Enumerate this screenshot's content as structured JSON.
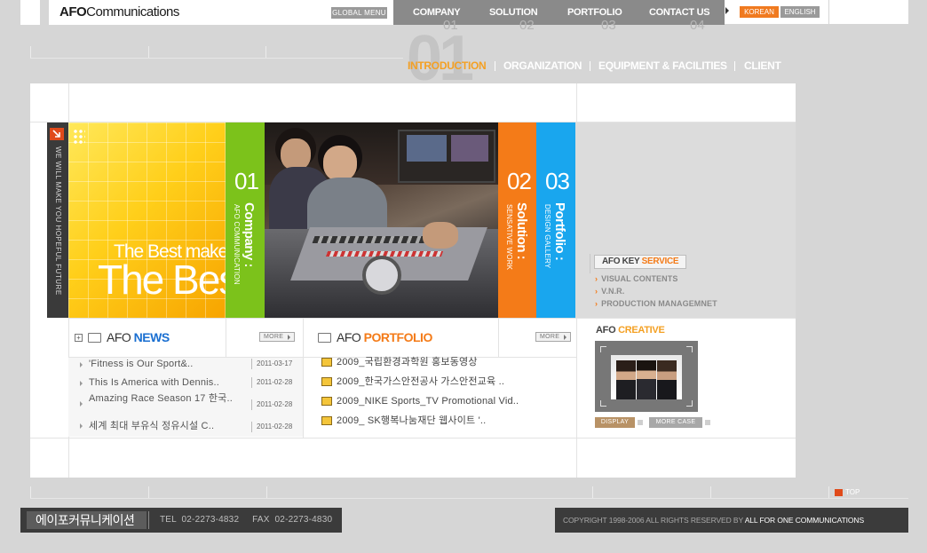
{
  "header": {
    "logo_bold": "AFO",
    "logo_rest": "Communications",
    "global_menu": "GLOBAL MENU",
    "nav": [
      {
        "label": "COMPANY",
        "num": "01"
      },
      {
        "label": "SOLUTION",
        "num": "02"
      },
      {
        "label": "PORTFOLIO",
        "num": "03"
      },
      {
        "label": "CONTACT US",
        "num": "04"
      }
    ],
    "lang_korean": "KOREAN",
    "lang_english": "ENGLISH",
    "big_number": "01"
  },
  "subnav": [
    {
      "label": "INTRODUCTION",
      "active": true
    },
    {
      "label": "ORGANIZATION",
      "active": false
    },
    {
      "label": "EQUIPMENT & FACILITIES",
      "active": false
    },
    {
      "label": "CLIENT",
      "active": false
    }
  ],
  "banner": {
    "side_text": "WE WILL MAKE YOU HOPEFUL FUTURE",
    "tagline_small": "The Best make",
    "tagline_big": "The Best",
    "bands": [
      {
        "num": "01",
        "title": "Company :",
        "sub": "AFO COMMUNICATION"
      },
      {
        "num": "02",
        "title": "Solution :",
        "sub": "SENSATIVE WORK"
      },
      {
        "num": "03",
        "title": "Portfolio :",
        "sub": "DESIGN GALLERY"
      }
    ],
    "colors": {
      "yellow": "#ffcf1a",
      "green": "#7cc21b",
      "orange": "#f47b18",
      "blue": "#19a6ee"
    }
  },
  "key_service": {
    "title_prefix": "AFO KEY ",
    "title_highlight": "SERVICE",
    "items": [
      "VISUAL CONTENTS",
      "V.N.R.",
      "PRODUCTION MANAGEMNET"
    ]
  },
  "news": {
    "title_prefix": "AFO ",
    "title_highlight": "NEWS",
    "more": "MORE",
    "items": [
      {
        "title": "'Fitness is Our Sport&..",
        "date": "2011-03-17"
      },
      {
        "title": "This Is America with Dennis..",
        "date": "2011-02-28"
      },
      {
        "title": "Amazing Race Season 17 한국..",
        "date": "2011-02-28"
      },
      {
        "title": "세계 최대 부유식 정유시설 C..",
        "date": "2011-02-28"
      }
    ]
  },
  "portfolio": {
    "title_prefix": "AFO ",
    "title_highlight": "PORTFOLIO",
    "more": "MORE",
    "items": [
      "2009_국립환경과학원 홍보동영상",
      "2009_한국가스안전공사 가스안전교육 ..",
      "2009_NIKE Sports_TV Promotional Vid..",
      "2009_ SK행복나눔재단 웹사이트 '.."
    ]
  },
  "creative": {
    "title_prefix": "AFO ",
    "title_highlight": "CREATIVE",
    "display": "DISPLAY",
    "more_case": "MORE CASE"
  },
  "footer": {
    "top_label": "TOP",
    "company": "에이포커뮤니케이션",
    "tel": "TEL  02-2273-4832     FAX  02-2273-4830",
    "copyright": "COPYRIGHT 1998-2006  ALL RIGHTS RESERVED BY ",
    "copyright_owner": "ALL FOR ONE COMMUNICATIONS"
  }
}
